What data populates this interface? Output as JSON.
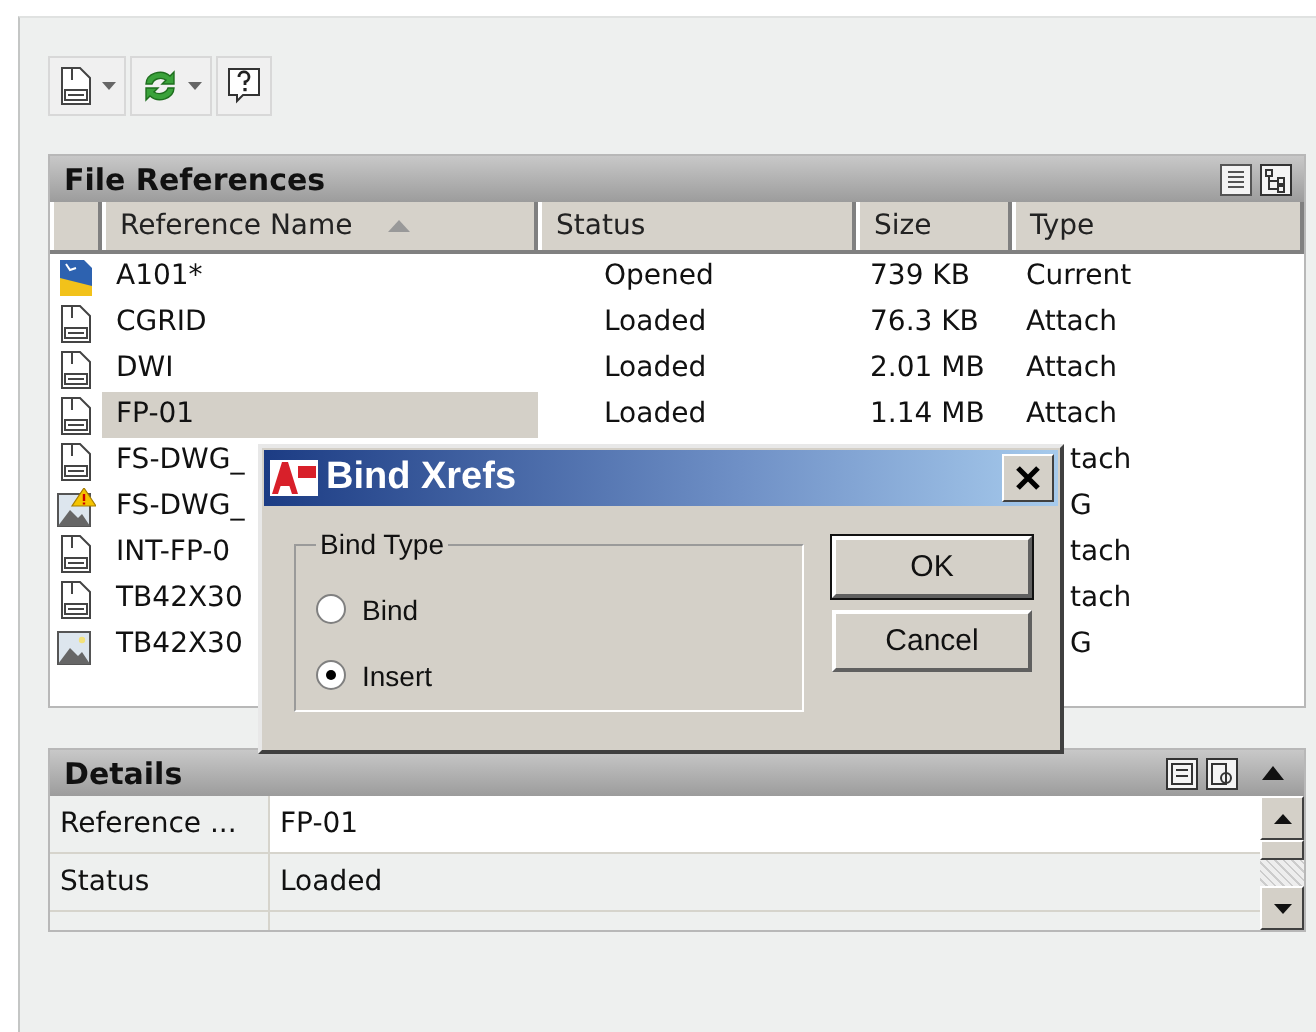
{
  "toolbar": {
    "buttons": [
      {
        "kind": "attach",
        "dropdown": true
      },
      {
        "kind": "refresh",
        "dropdown": true
      },
      {
        "kind": "help",
        "dropdown": false
      }
    ]
  },
  "file_references": {
    "title": "File References",
    "columns": [
      {
        "label": "Reference Name",
        "sorted": true
      },
      {
        "label": "Status",
        "sorted": false
      },
      {
        "label": "Size",
        "sorted": false
      },
      {
        "label": "Type",
        "sorted": false
      }
    ],
    "rows": [
      {
        "kind": "current",
        "name": "A101*",
        "status": "Opened",
        "size": "739 KB",
        "type": "Current",
        "selected": false
      },
      {
        "kind": "dwg",
        "name": "CGRID",
        "status": "Loaded",
        "size": "76.3 KB",
        "type": "Attach",
        "selected": false
      },
      {
        "kind": "dwg",
        "name": "DWI",
        "status": "Loaded",
        "size": "2.01 MB",
        "type": "Attach",
        "selected": false
      },
      {
        "kind": "dwg",
        "name": "FP-01",
        "status": "Loaded",
        "size": "1.14 MB",
        "type": "Attach",
        "selected": true
      },
      {
        "kind": "dwg",
        "name": "FS-DWG_",
        "type": "tach",
        "selected": false
      },
      {
        "kind": "image-warning",
        "name": "FS-DWG_",
        "type": "G",
        "selected": false
      },
      {
        "kind": "dwg",
        "name": "INT-FP-0",
        "type": "tach",
        "selected": false
      },
      {
        "kind": "dwg",
        "name": "TB42X30",
        "type": "tach",
        "selected": false
      },
      {
        "kind": "image",
        "name": "TB42X30",
        "type": "G",
        "selected": false
      }
    ]
  },
  "details": {
    "title": "Details",
    "rows": [
      {
        "label": "Reference ...",
        "value": "FP-01",
        "selected": true
      },
      {
        "label": "Status",
        "value": "Loaded",
        "selected": false
      }
    ]
  },
  "dialog": {
    "title": "Bind Xrefs",
    "group": "Bind Type",
    "options": [
      {
        "label": "Bind",
        "selected": false
      },
      {
        "label": "Insert",
        "selected": true
      }
    ],
    "buttons": [
      {
        "label": "OK",
        "default": true
      },
      {
        "label": "Cancel",
        "default": false
      }
    ]
  }
}
